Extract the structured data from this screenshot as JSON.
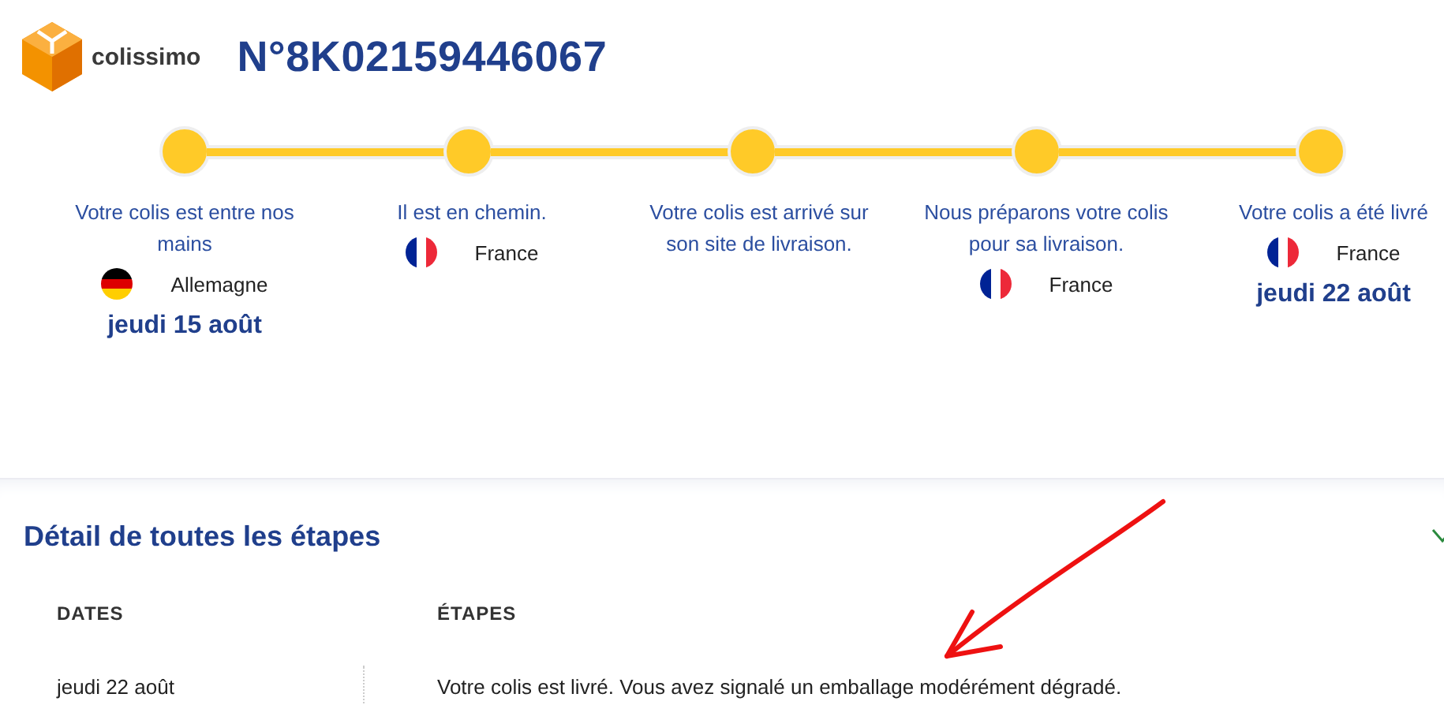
{
  "header": {
    "brand": "colissimo",
    "tracking_number": "N°8K02159446067"
  },
  "steps": [
    {
      "text": "Votre colis est entre nos mains",
      "country": "Allemagne",
      "kind": "de",
      "date": "jeudi 15 août"
    },
    {
      "text": "Il est en chemin.",
      "country": "France",
      "kind": "fr"
    },
    {
      "text": "Votre colis est arrivé sur son site de livraison."
    },
    {
      "text": "Nous préparons votre colis pour sa livraison.",
      "country": "France",
      "kind": "fr"
    },
    {
      "text": "Votre colis a été livré",
      "country": "France",
      "kind": "fr",
      "date": "jeudi 22 août"
    }
  ],
  "details": {
    "title": "Détail de toutes les étapes",
    "expanded": true,
    "columns": [
      "DATES",
      "ÉTAPES"
    ],
    "rows": [
      {
        "date": "jeudi 22 août",
        "step": "Votre colis est livré. Vous avez signalé un emballage modérément dégradé."
      }
    ]
  }
}
